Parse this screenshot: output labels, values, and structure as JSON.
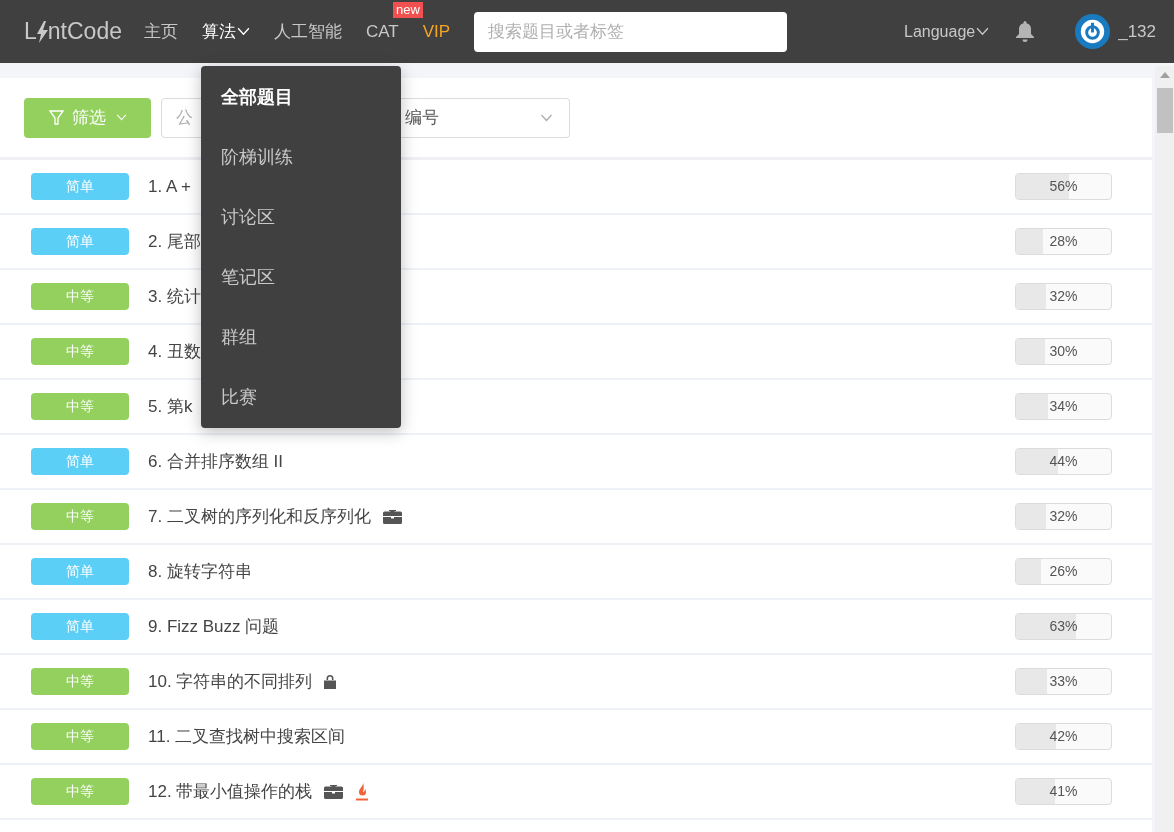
{
  "navbar": {
    "logo": {
      "before": "L",
      "after": "ntCode"
    },
    "links": [
      {
        "label": "主页",
        "selected": false,
        "dropdown": false,
        "kind": "plain"
      },
      {
        "label": "算法",
        "selected": true,
        "dropdown": true,
        "kind": "plain"
      },
      {
        "label": "人工智能",
        "selected": false,
        "dropdown": false,
        "kind": "plain"
      },
      {
        "label": "CAT",
        "selected": false,
        "dropdown": false,
        "kind": "plain",
        "badge": "new"
      },
      {
        "label": "VIP",
        "selected": false,
        "dropdown": false,
        "kind": "vip"
      }
    ],
    "search": {
      "placeholder": "搜索题目或者标签"
    },
    "language": "Language",
    "username": "_132"
  },
  "menu": {
    "items": [
      {
        "label": "全部题目",
        "selected": true
      },
      {
        "label": "阶梯训练",
        "selected": false
      },
      {
        "label": "讨论区",
        "selected": false
      },
      {
        "label": "笔记区",
        "selected": false
      },
      {
        "label": "群组",
        "selected": false
      },
      {
        "label": "比赛",
        "selected": false
      }
    ]
  },
  "toolbar": {
    "filter": "筛选",
    "company_placeholder": "公",
    "sort": "编号"
  },
  "problems": [
    {
      "difficulty": "简单",
      "kind": "easy",
      "title": "1. A +",
      "company": false,
      "locked": false,
      "hot": false,
      "rate": "56%",
      "level": 0.56
    },
    {
      "difficulty": "简单",
      "kind": "easy",
      "title": "2. 尾部",
      "company": false,
      "locked": false,
      "hot": false,
      "rate": "28%",
      "level": 0.28
    },
    {
      "difficulty": "中等",
      "kind": "medium",
      "title": "3. 统计",
      "company": false,
      "locked": false,
      "hot": false,
      "rate": "32%",
      "level": 0.32
    },
    {
      "difficulty": "中等",
      "kind": "medium",
      "title": "4. 丑数",
      "company": false,
      "locked": false,
      "hot": false,
      "rate": "30%",
      "level": 0.3
    },
    {
      "difficulty": "中等",
      "kind": "medium",
      "title": "5. 第k",
      "company": false,
      "locked": false,
      "hot": false,
      "rate": "34%",
      "level": 0.34
    },
    {
      "difficulty": "简单",
      "kind": "easy",
      "title": "6. 合并排序数组 II",
      "company": false,
      "locked": false,
      "hot": false,
      "rate": "44%",
      "level": 0.44
    },
    {
      "difficulty": "中等",
      "kind": "medium",
      "title": "7. 二叉树的序列化和反序列化",
      "company": true,
      "locked": false,
      "hot": false,
      "rate": "32%",
      "level": 0.32
    },
    {
      "difficulty": "简单",
      "kind": "easy",
      "title": "8. 旋转字符串",
      "company": false,
      "locked": false,
      "hot": false,
      "rate": "26%",
      "level": 0.26
    },
    {
      "difficulty": "简单",
      "kind": "easy",
      "title": "9. Fizz Buzz 问题",
      "company": false,
      "locked": false,
      "hot": false,
      "rate": "63%",
      "level": 0.63
    },
    {
      "difficulty": "中等",
      "kind": "medium",
      "title": "10. 字符串的不同排列",
      "company": false,
      "locked": true,
      "hot": false,
      "rate": "33%",
      "level": 0.33
    },
    {
      "difficulty": "中等",
      "kind": "medium",
      "title": "11. 二叉查找树中搜索区间",
      "company": false,
      "locked": false,
      "hot": false,
      "rate": "42%",
      "level": 0.42
    },
    {
      "difficulty": "中等",
      "kind": "medium",
      "title": "12. 带最小值操作的栈",
      "company": true,
      "locked": false,
      "hot": true,
      "rate": "41%",
      "level": 0.41
    }
  ]
}
